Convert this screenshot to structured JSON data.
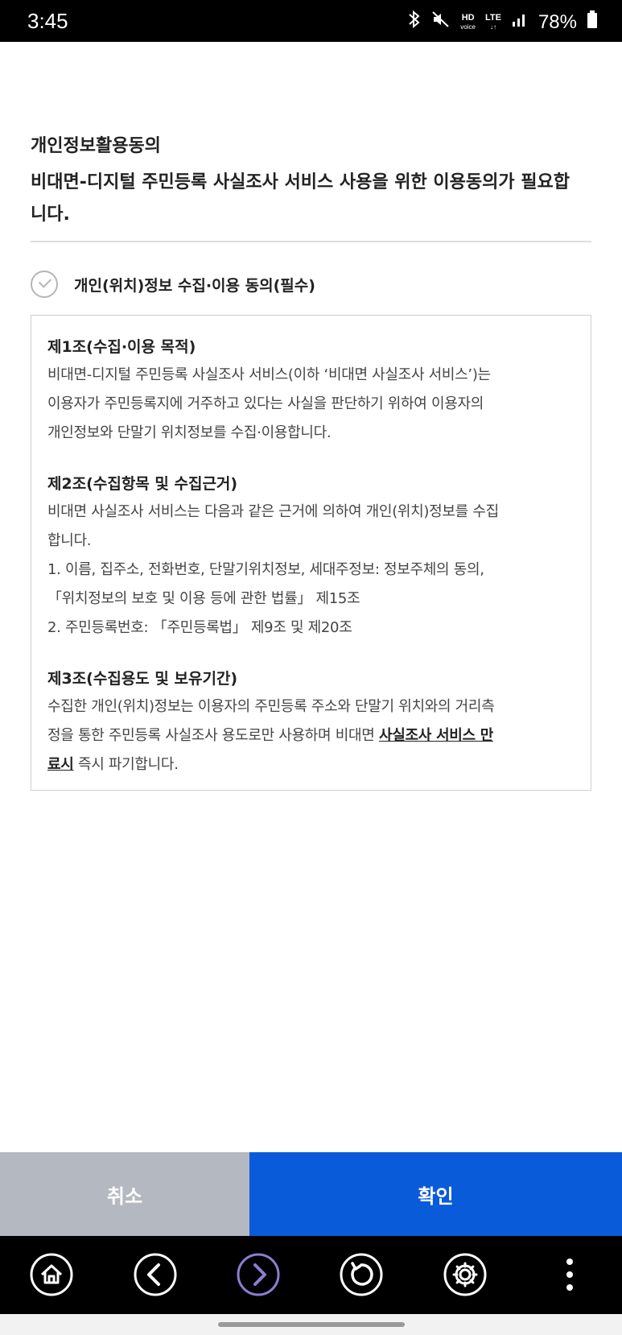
{
  "status_bar": {
    "time": "3:45",
    "hd_label": "HD",
    "voice_label": "voice",
    "lte_label": "LTE",
    "battery": "78%"
  },
  "header": {
    "title": "개인정보활용동의",
    "subtitle_line1": "비대면-디지털 주민등록 사실조사 서비스 사용을 위한 이용동의가 필요합",
    "subtitle_line2": "니다."
  },
  "consent": {
    "label": "개인(위치)정보 수집·이용 동의(필수)",
    "checked": false
  },
  "terms": {
    "articles": [
      {
        "title": "제1조(수집·이용 목적)",
        "lines": [
          "비대면-디지털 주민등록 사실조사 서비스(이하 ‘비대면 사실조사 서비스’)는",
          "이용자가 주민등록지에 거주하고 있다는 사실을 판단하기 위하여 이용자의",
          "개인정보와 단말기 위치정보를 수집·이용합니다."
        ]
      },
      {
        "title": "제2조(수집항목 및 수집근거)",
        "lines": [
          "비대면 사실조사 서비스는 다음과 같은 근거에 의하여 개인(위치)정보를 수집",
          "합니다.",
          "1. 이름, 집주소, 전화번호, 단말기위치정보, 세대주정보: 정보주체의 동의,",
          "「위치정보의 보호 및 이용 등에 관한 법률」 제15조",
          "2. 주민등록번호: 「주민등록법」 제9조 및 제20조"
        ]
      },
      {
        "title": "제3조(수집용도 및 보유기간)",
        "line1": "수집한 개인(위치)정보는 이용자의 주민등록 주소와 단말기 위치와의 거리측",
        "line2_plain": "정을 통한 주민등록 사실조사 용도로만 사용하며 비대면 ",
        "line2_emph": "사실조사 서비스 만",
        "line3_emph": "료시",
        "line3_plain": " 즉시 파기합니다."
      }
    ]
  },
  "buttons": {
    "cancel": "취소",
    "confirm": "확인"
  },
  "nav_bar": {
    "icons": [
      "home-icon",
      "back-icon",
      "forward-icon",
      "refresh-icon",
      "settings-icon",
      "more-icon"
    ]
  },
  "colors": {
    "confirm_bg": "#0a5bd9",
    "cancel_bg": "#b4b8c1",
    "forward_accent": "#8a7fd4"
  }
}
